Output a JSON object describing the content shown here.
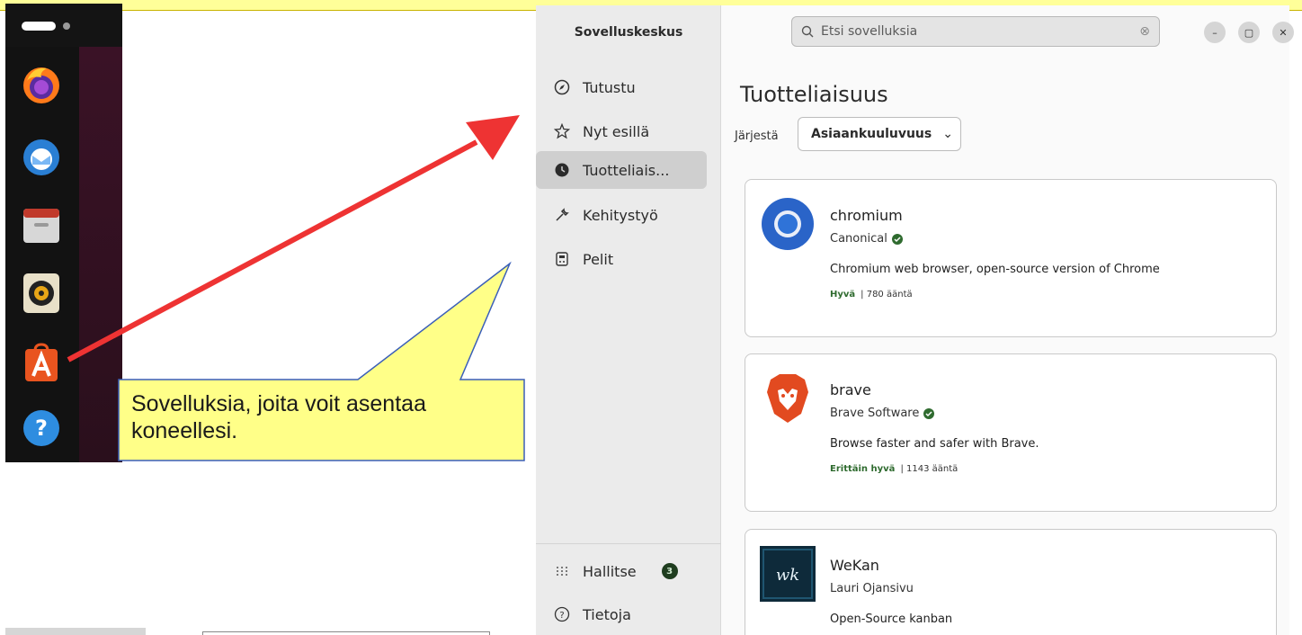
{
  "dock": {
    "icons": [
      "firefox-icon",
      "thunderbird-icon",
      "files-icon",
      "rhythmbox-icon",
      "app-center-icon",
      "help-icon"
    ]
  },
  "app": {
    "title": "Sovelluskeskus",
    "search": {
      "placeholder": "Etsi sovelluksia"
    },
    "nav": [
      {
        "label": "Tutustu",
        "icon": "compass-icon",
        "active": false
      },
      {
        "label": "Nyt esillä",
        "icon": "star-icon",
        "active": false
      },
      {
        "label": "Tuotteliais...",
        "icon": "clock-icon",
        "active": true
      },
      {
        "label": "Kehitystyö",
        "icon": "wrench-icon",
        "active": false
      },
      {
        "label": "Pelit",
        "icon": "gamepad-icon",
        "active": false
      }
    ],
    "manage": {
      "label": "Hallitse",
      "badge": "3"
    },
    "about": {
      "label": "Tietoja"
    },
    "page_title": "Tuotteliaisuus",
    "sort": {
      "label": "Järjestä",
      "value": "Asiaankuuluvuus"
    },
    "cards": [
      {
        "name": "chromium",
        "publisher": "Canonical",
        "verified": true,
        "description": "Chromium web browser, open-source version of Chrome",
        "rating": "Hyvä",
        "votes": "| 780 ääntä"
      },
      {
        "name": "brave",
        "publisher": "Brave Software",
        "verified": true,
        "description": "Browse faster and safer with Brave.",
        "rating": "Erittäin hyvä",
        "votes": "| 1143 ääntä"
      },
      {
        "name": "WeKan",
        "publisher": "Lauri Ojansivu",
        "verified": false,
        "description": "Open-Source kanban",
        "rating": "",
        "votes": ""
      }
    ]
  },
  "annotation": {
    "callout_text": "Sovelluksia, joita voit asentaa koneellesi.",
    "arrow_color": "#ee3333",
    "callout_fill": "#ffff88"
  }
}
